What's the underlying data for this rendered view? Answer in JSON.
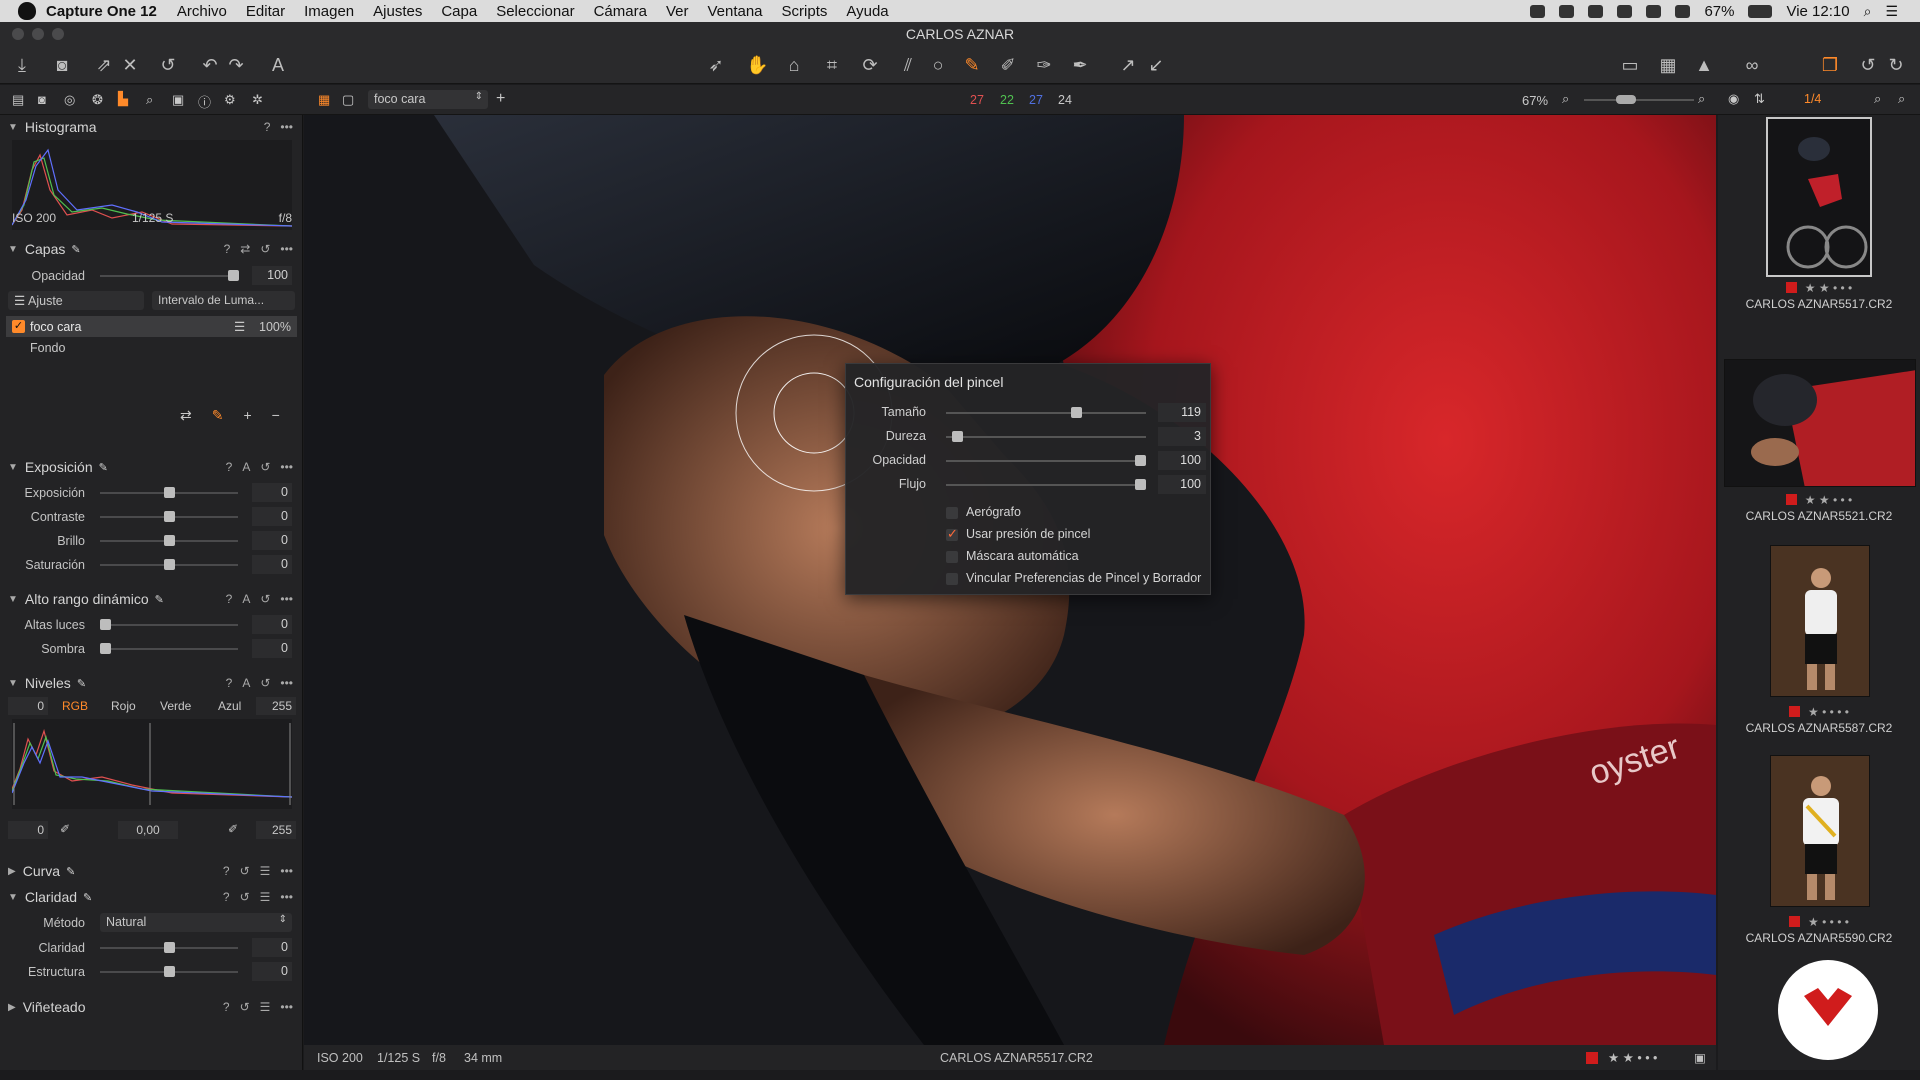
{
  "menubar": {
    "app": "Capture One 12",
    "items": [
      "Archivo",
      "Editar",
      "Imagen",
      "Ajustes",
      "Capa",
      "Seleccionar",
      "Cámara",
      "Ver",
      "Ventana",
      "Scripts",
      "Ayuda"
    ],
    "battery": "67%",
    "clock": "Vie 12:10"
  },
  "window": {
    "title": "CARLOS AZNAR"
  },
  "subbar": {
    "layer_select": "foco cara",
    "counts": [
      "27",
      "22",
      "27",
      "24"
    ],
    "count_colors": [
      "#e05050",
      "#50c050",
      "#5070e0",
      "#c8c8c8"
    ],
    "zoom": "67%",
    "page": "1/4"
  },
  "histogram": {
    "title": "Histograma",
    "iso": "ISO 200",
    "shutter": "1/125 S",
    "aperture": "f/8"
  },
  "capas": {
    "title": "Capas",
    "opacity_label": "Opacidad",
    "opacity_value": "100",
    "adjust_label": "Ajuste",
    "range_label": "Intervalo de Luma...",
    "layers": [
      {
        "name": "foco cara",
        "value": "100%"
      },
      {
        "name": "Fondo"
      }
    ]
  },
  "exposicion": {
    "title": "Exposición",
    "rows": [
      {
        "label": "Exposición",
        "value": "0"
      },
      {
        "label": "Contraste",
        "value": "0"
      },
      {
        "label": "Brillo",
        "value": "0"
      },
      {
        "label": "Saturación",
        "value": "0"
      }
    ]
  },
  "hdr": {
    "title": "Alto rango dinámico",
    "rows": [
      {
        "label": "Altas luces",
        "value": "0"
      },
      {
        "label": "Sombra",
        "value": "0"
      }
    ]
  },
  "niveles": {
    "title": "Niveles",
    "tabs": [
      "RGB",
      "Rojo",
      "Verde",
      "Azul"
    ],
    "left": "0",
    "right": "255",
    "mid": "0,00",
    "out_left": "0",
    "out_right": "255"
  },
  "curva": {
    "title": "Curva"
  },
  "claridad": {
    "title": "Claridad",
    "method_label": "Método",
    "method_value": "Natural",
    "rows": [
      {
        "label": "Claridad",
        "value": "0"
      },
      {
        "label": "Estructura",
        "value": "0"
      }
    ]
  },
  "vineteado": {
    "title": "Viñeteado"
  },
  "brush": {
    "title": "Configuración del pincel",
    "rows": [
      {
        "label": "Tamaño",
        "value": "119",
        "level": 0.66
      },
      {
        "label": "Dureza",
        "value": "3",
        "level": 0.03
      },
      {
        "label": "Opacidad",
        "value": "100",
        "level": 1
      },
      {
        "label": "Flujo",
        "value": "100",
        "level": 1
      }
    ],
    "checks": [
      {
        "label": "Aerógrafo",
        "on": false
      },
      {
        "label": "Usar presión de pincel",
        "on": true
      },
      {
        "label": "Máscara automática",
        "on": false
      },
      {
        "label": "Vincular Preferencias de Pincel y Borrador",
        "on": false
      }
    ]
  },
  "status": {
    "iso": "ISO 200",
    "shutter": "1/125 S",
    "aperture": "f/8",
    "focal": "34 mm",
    "file": "CARLOS AZNAR5517.CR2",
    "stars": "★ ★ • • •"
  },
  "browser": [
    {
      "file": "CARLOS AZNAR5517.CR2",
      "stars": "★ ★ • • •"
    },
    {
      "file": "CARLOS AZNAR5521.CR2",
      "stars": "★ ★ • • •"
    },
    {
      "file": "CARLOS AZNAR5587.CR2",
      "stars": "★ • • • •"
    },
    {
      "file": "CARLOS AZNAR5590.CR2",
      "stars": "★ • • • •"
    }
  ],
  "photo_text": "oyster",
  "brand_color": "#d01c1c"
}
